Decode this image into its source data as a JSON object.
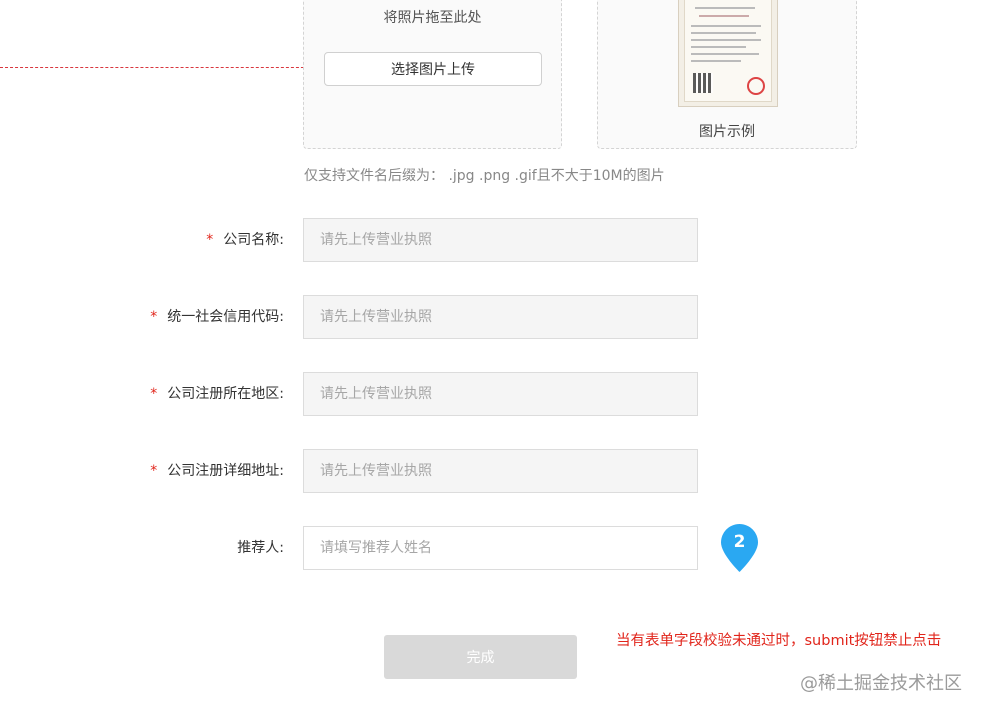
{
  "upload": {
    "drop_text": "将照片拖至此处",
    "button_label": "选择图片上传"
  },
  "example": {
    "caption": "图片示例"
  },
  "hint": "仅支持文件名后缀为： .jpg .png .gif且不大于10M的图片",
  "form": {
    "required_mark": "*",
    "fields": [
      {
        "label": "公司名称:",
        "placeholder": "请先上传营业执照",
        "required": true,
        "editable": false
      },
      {
        "label": "统一社会信用代码:",
        "placeholder": "请先上传营业执照",
        "required": true,
        "editable": false
      },
      {
        "label": "公司注册所在地区:",
        "placeholder": "请先上传营业执照",
        "required": true,
        "editable": false
      },
      {
        "label": "公司注册详细地址:",
        "placeholder": "请先上传营业执照",
        "required": true,
        "editable": false
      },
      {
        "label": "推荐人:",
        "placeholder": "请填写推荐人姓名",
        "required": false,
        "editable": true
      }
    ],
    "submit_label": "完成"
  },
  "marker": {
    "number": "2",
    "color": "#2aa8f2"
  },
  "annotation": "当有表单字段校验未通过时，submit按钮禁止点击",
  "watermark": "@稀土掘金技术社区",
  "colors": {
    "required": "#e1251b",
    "disabled_button": "#d9d9d9",
    "annotation": "#e1251b"
  }
}
